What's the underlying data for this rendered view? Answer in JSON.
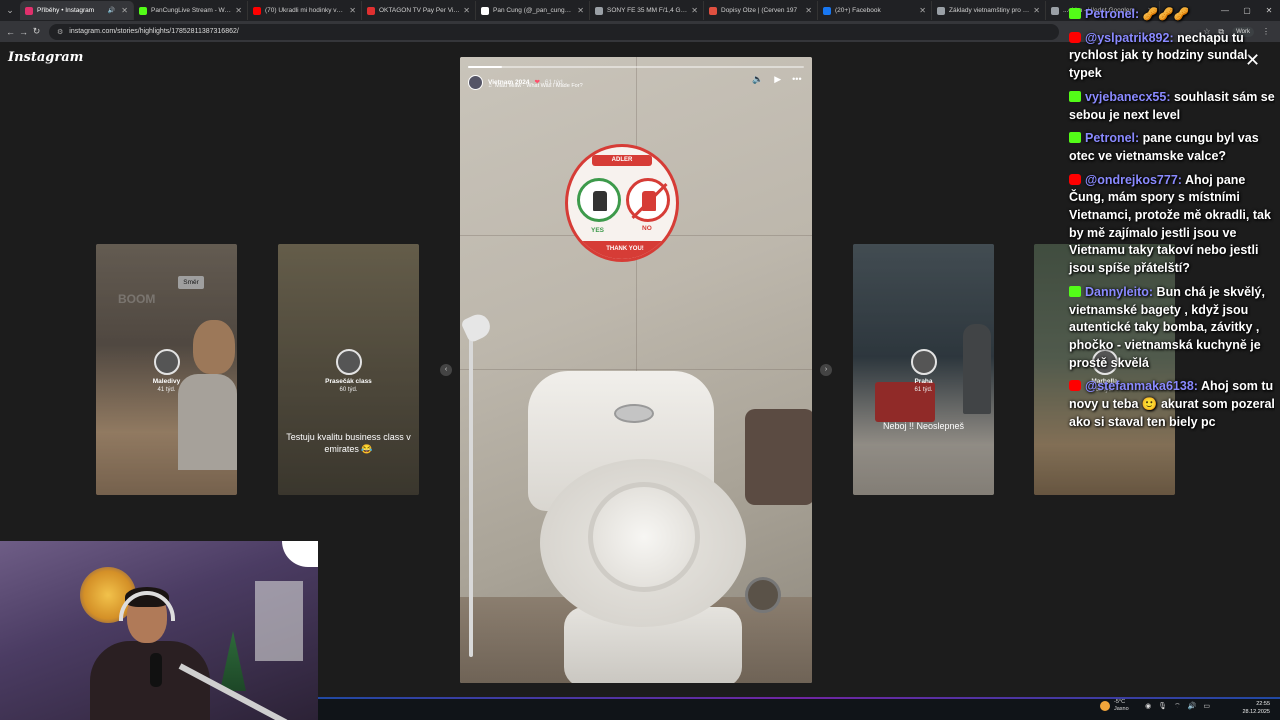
{
  "browser": {
    "tabs": [
      {
        "title": "Příběhy • Instagram",
        "color": "#e1306c",
        "active": true,
        "audio": true
      },
      {
        "title": "PanCungLive Stream - Watch",
        "color": "#53fc18",
        "active": false,
        "audio": false
      },
      {
        "title": "(70) Ukradli mi hodinky ve Ep",
        "color": "#ff0000",
        "active": false,
        "audio": false
      },
      {
        "title": "OKTAGON TV Pay Per View",
        "color": "#e03030",
        "active": false,
        "audio": false
      },
      {
        "title": "Pan Čung (@_pan_cung_) vyt",
        "color": "#ffffff",
        "active": false,
        "audio": false
      },
      {
        "title": "SONY FE 35 MM F/1,4 GM SE",
        "color": "#9aa0a6",
        "active": false,
        "audio": false
      },
      {
        "title": "Dopisy Olze | (Červen 197",
        "color": "#e05040",
        "active": false,
        "audio": false
      },
      {
        "title": "(20+) Facebook",
        "color": "#1877f2",
        "active": false,
        "audio": false
      },
      {
        "title": "Základy vietnamštiny pro stre",
        "color": "#9aa0a6",
        "active": false,
        "audio": false
      },
      {
        "title": "...chim - Hledat Googlem",
        "color": "#9aa0a6",
        "active": false,
        "audio": false
      }
    ],
    "url": "instagram.com/stories/highlights/17852811387316862/",
    "profile_label": "Work"
  },
  "instagram": {
    "logo": "Instagram",
    "story": {
      "title": "Vietnam 2024",
      "ago": "61 týd.",
      "music": "Miau Miaw · What Was I Made For?",
      "progress": 0.1,
      "sticker": {
        "brand": "ADLER",
        "yes": "YES",
        "no": "NO",
        "thanks": "THANK YOU!"
      }
    },
    "cards": [
      {
        "name": "Maledivy",
        "ago": "41 týd.",
        "caption": "",
        "sign": "Směr",
        "boom": "BOOM"
      },
      {
        "name": "Prasečák class",
        "ago": "60 týd.",
        "caption": "Testuju kvalitu business class v emirates 😂"
      },
      {
        "name": "Praha",
        "ago": "61 týd.",
        "caption": "Neboj !! Neoslepneš"
      },
      {
        "name": "Marbella",
        "ago": "65 týd.",
        "caption": ""
      }
    ]
  },
  "chat": [
    {
      "platform": "kick",
      "user": "Petronel",
      "text": "🥜🥜🥜"
    },
    {
      "platform": "yt",
      "user": "@yslpatrik892",
      "text": "nechapu tu rychlost jak ty hodziny sundal typek"
    },
    {
      "platform": "kick",
      "user": "vyjebanecx55",
      "text": "souhlasit sám se sebou je next level"
    },
    {
      "platform": "kick",
      "user": "Petronel",
      "text": "pane cungu byl vas otec ve vietnamske valce?"
    },
    {
      "platform": "yt",
      "user": "@ondrejkos777",
      "text": "Ahoj pane Čung, mám spory s místními Vietnamci, protože mě okradli, tak by mě zajímalo jestli jsou ve Vietnamu taky takoví nebo jestli jsou spíše přátelští?"
    },
    {
      "platform": "kick",
      "user": "Dannyleito",
      "text": "Bun chá je skvělý, vietnamské bagety , když jsou autentické taky bomba, závitky , phočko - vietnamská kuchyně je prostě skvělá"
    },
    {
      "platform": "yt",
      "user": "@stefanmaka6138",
      "text": "Ahoj som tu novy u teba 🙂 akurat som pozeral ako si staval ten biely pc"
    }
  ],
  "taskbar": {
    "temp": "-5°C",
    "weather": "Jasno",
    "time": "22:55",
    "date": "28.12.2025"
  }
}
